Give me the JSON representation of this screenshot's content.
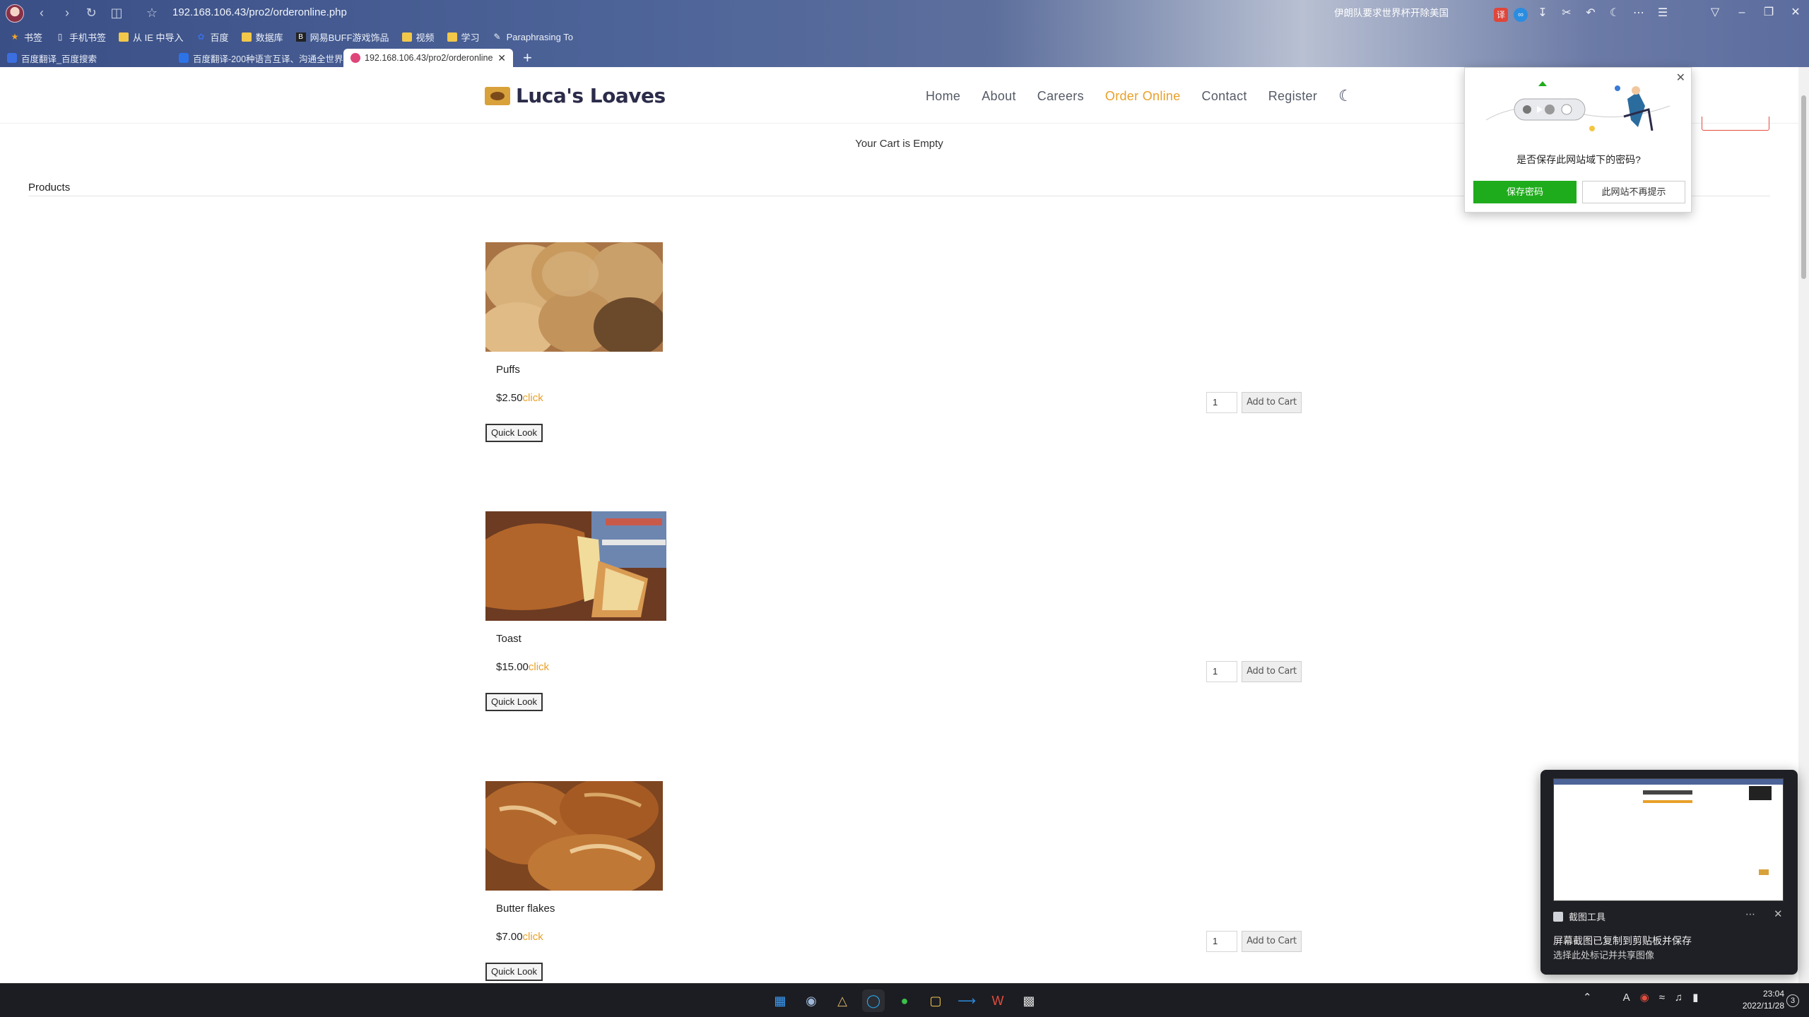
{
  "browser": {
    "url": "192.168.106.43/pro2/orderonline.php",
    "search_text": "伊朗队要求世界杯开除美国",
    "bookmarks": [
      {
        "label": "书签",
        "icon": "star-icon"
      },
      {
        "label": "手机书签",
        "icon": "phone-icon"
      },
      {
        "label": "从 IE 中导入",
        "icon": "folder-icon"
      },
      {
        "label": "百度",
        "icon": "baidu-icon"
      },
      {
        "label": "数据库",
        "icon": "folder-icon"
      },
      {
        "label": "网易BUFF游戏饰品",
        "icon": "buff-icon"
      },
      {
        "label": "视频",
        "icon": "folder-icon"
      },
      {
        "label": "学习",
        "icon": "folder-icon"
      },
      {
        "label": "Paraphrasing To",
        "icon": "pen-icon"
      }
    ],
    "tabs": [
      {
        "label": "百度翻译_百度搜索",
        "active": false
      },
      {
        "label": "百度翻译-200种语言互译、沟通全世界",
        "active": false
      },
      {
        "label": "192.168.106.43/pro2/orderonline",
        "active": true
      }
    ]
  },
  "site": {
    "logo_text": "Luca's Loaves",
    "nav": {
      "home": "Home",
      "about": "About",
      "careers": "Careers",
      "order": "Order Online",
      "contact": "Contact",
      "register": "Register"
    },
    "accent_color": "#e8a02a"
  },
  "cart": {
    "message": "Your Cart is Empty"
  },
  "products_section": {
    "title": "Products"
  },
  "products": [
    {
      "name": "Puffs",
      "price": "$2.50",
      "click_label": "click",
      "quick_look": "Quick Look",
      "qty": "1",
      "add_label": "Add to Cart"
    },
    {
      "name": "Toast",
      "price": "$15.00",
      "click_label": "click",
      "quick_look": "Quick Look",
      "qty": "1",
      "add_label": "Add to Cart"
    },
    {
      "name": "Butter flakes",
      "price": "$7.00",
      "click_label": "click",
      "quick_look": "Quick Look",
      "qty": "1",
      "add_label": "Add to Cart"
    }
  ],
  "password_popup": {
    "question": "是否保存此网站域下的密码?",
    "save_label": "保存密码",
    "never_label": "此网站不再提示"
  },
  "snip_toast": {
    "app_name": "截图工具",
    "title": "屏幕截图已复制到剪贴板并保存",
    "body": "选择此处标记并共享图像"
  },
  "taskbar": {
    "time": "23:04",
    "date": "2022/11/28",
    "notification_count": "3"
  }
}
